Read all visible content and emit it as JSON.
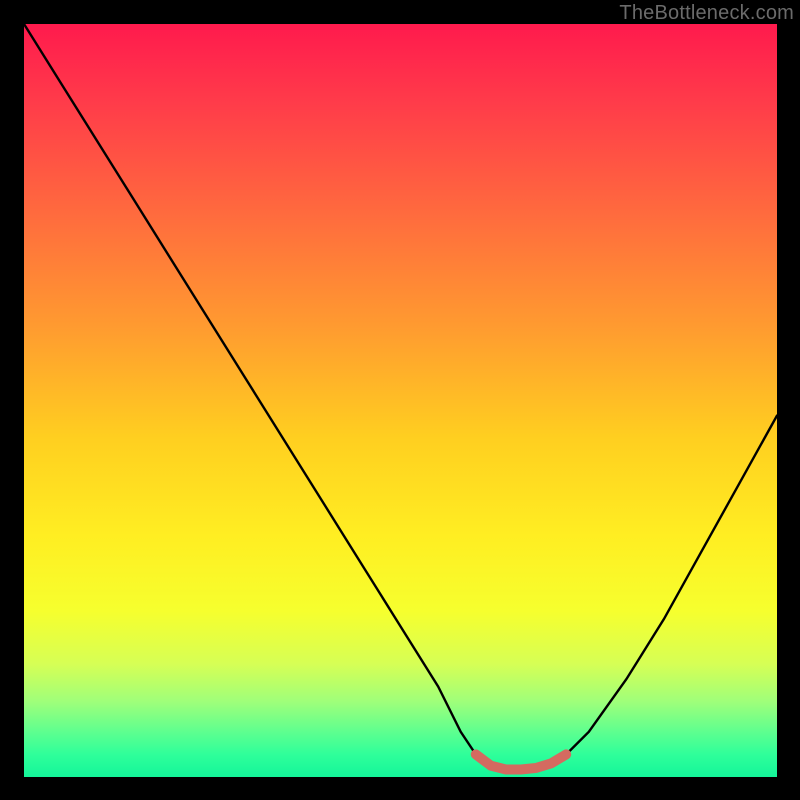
{
  "watermark": "TheBottleneck.com",
  "chart_data": {
    "type": "line",
    "title": "",
    "xlabel": "",
    "ylabel": "",
    "xlim": [
      0,
      100
    ],
    "ylim": [
      0,
      100
    ],
    "series": [
      {
        "name": "bottleneck-curve",
        "x": [
          0,
          5,
          10,
          15,
          20,
          25,
          30,
          35,
          40,
          45,
          50,
          55,
          58,
          60,
          62,
          64,
          66,
          68,
          70,
          72,
          75,
          80,
          85,
          90,
          95,
          100
        ],
        "values": [
          100,
          92,
          84,
          76,
          68,
          60,
          52,
          44,
          36,
          28,
          20,
          12,
          6,
          3,
          1.5,
          1,
          1,
          1.2,
          1.8,
          3,
          6,
          13,
          21,
          30,
          39,
          48
        ]
      }
    ],
    "highlight": {
      "name": "optimal-range",
      "x": [
        60,
        62,
        64,
        66,
        68,
        70,
        72
      ],
      "values": [
        3,
        1.5,
        1,
        1,
        1.2,
        1.8,
        3
      ],
      "color": "#d46a60"
    },
    "colors": {
      "gradient_top": "#ff1a4d",
      "gradient_bottom": "#14f59a",
      "curve": "#000000",
      "highlight": "#d46a60",
      "frame": "#000000"
    }
  }
}
